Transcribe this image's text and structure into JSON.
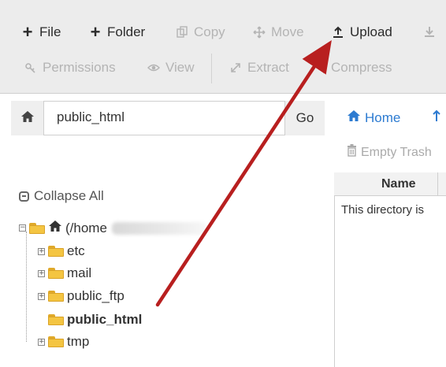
{
  "toolbar": {
    "file": "File",
    "folder": "Folder",
    "copy": "Copy",
    "move": "Move",
    "upload": "Upload",
    "permissions": "Permissions",
    "view": "View",
    "extract": "Extract",
    "compress": "Compress"
  },
  "path_bar": {
    "value": "public_html",
    "go_label": "Go"
  },
  "tree": {
    "collapse_all": "Collapse All",
    "root_label": "(/home",
    "items": [
      {
        "label": "etc"
      },
      {
        "label": "mail"
      },
      {
        "label": "public_ftp"
      },
      {
        "label": "public_html",
        "selected": true
      },
      {
        "label": "tmp"
      }
    ]
  },
  "right_panel": {
    "home_label": "Home",
    "empty_trash_label": "Empty Trash",
    "column_name": "Name",
    "empty_message": "This directory is"
  },
  "colors": {
    "toolbar_bg": "#ececec",
    "link_blue": "#2d7bd1",
    "folder_yellow": "#f4c542",
    "annotation_arrow": "#b81f1f"
  },
  "icons": [
    "plus-icon",
    "copy-icon",
    "move-icon",
    "upload-icon",
    "key-icon",
    "eye-icon",
    "extract-icon",
    "home-icon",
    "folder-icon",
    "trash-icon",
    "collapse-icon"
  ]
}
